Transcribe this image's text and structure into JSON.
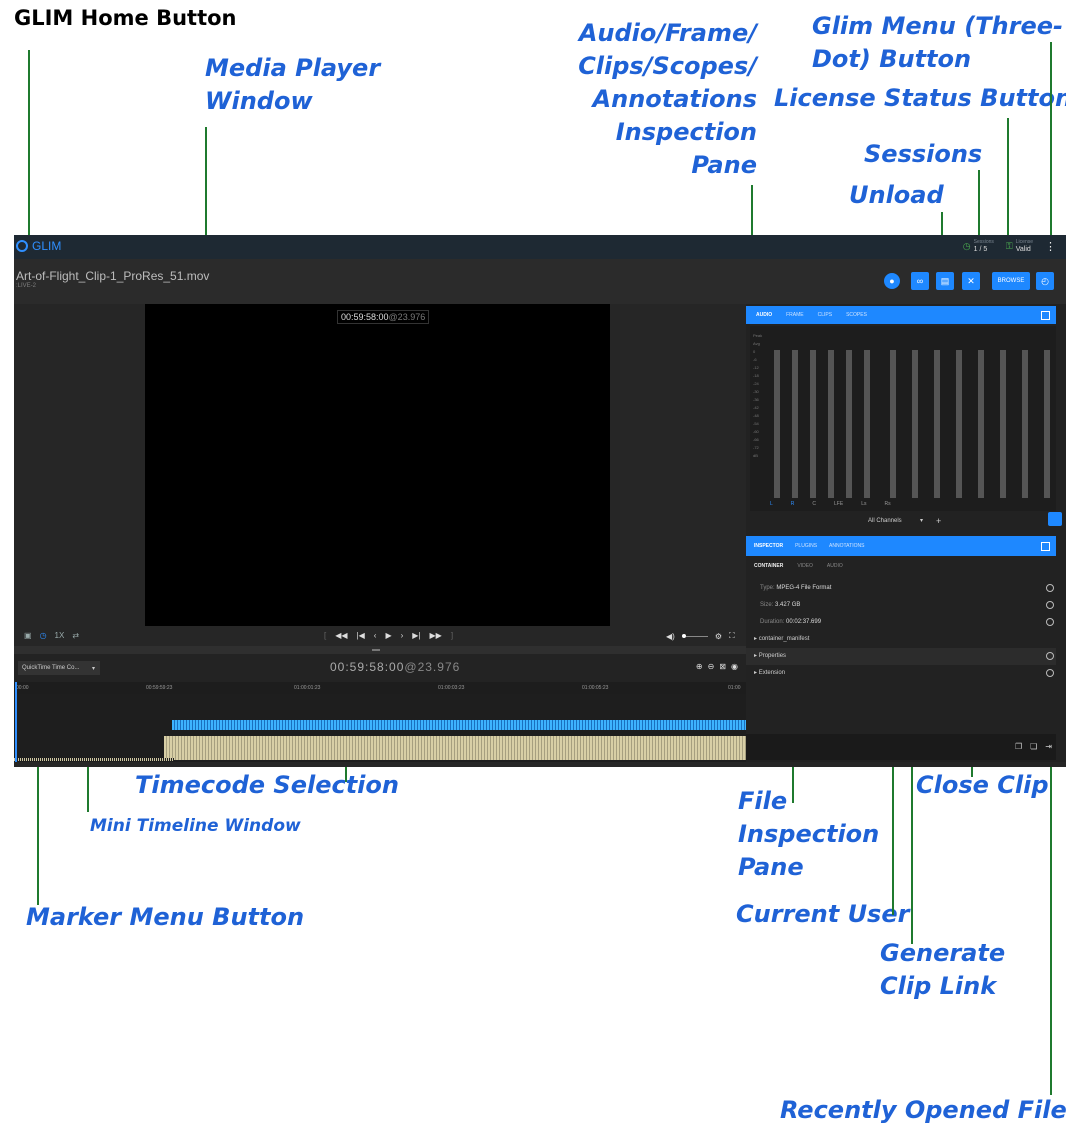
{
  "callouts": {
    "home_button": "GLIM Home Button",
    "media_player": [
      "Media Player",
      "Window"
    ],
    "inspection_pane": [
      "Audio/Frame/",
      "Clips/Scopes/",
      "Annotations",
      "Inspection",
      "Pane"
    ],
    "glim_menu": [
      "Glim Menu (Three-",
      "Dot) Button"
    ],
    "license_status": "License Status Button",
    "sessions": "Sessions",
    "unload": "Unload",
    "timecode_selection": "Timecode Selection",
    "mini_timeline": "Mini Timeline Window",
    "marker_menu": "Marker Menu Button",
    "file_inspection": [
      "File",
      "Inspection",
      "Pane"
    ],
    "close_clip": "Close Clip",
    "current_user": "Current User",
    "generate_clip_link": [
      "Generate",
      "Clip Link"
    ],
    "recently_opened": "Recently Opened Files"
  },
  "app": {
    "logo_text": "GLIM",
    "sessions": {
      "label": "Sessions",
      "value": "1 / 5"
    },
    "license": {
      "label": "License",
      "value": "Valid"
    },
    "menu_glyph": "⋮",
    "file_title": "Art-of-Flight_Clip-1_ProRes_51.mov",
    "file_sub": ":LIVE-2",
    "browse_label": "BROWSE",
    "player": {
      "timecode": "00:59:58:00",
      "rate": "@23.976",
      "speed": "1X"
    },
    "timeline": {
      "select_label": "QuickTime Time Co...",
      "timecode": "00:59:58:00",
      "rate": "@23.976",
      "ruler": [
        "00:00",
        "00:59:59:23",
        "01:00:01:23",
        "01:00:03:23",
        "01:00:05:23",
        "01:00"
      ]
    },
    "audio_tabs": [
      "AUDIO",
      "FRAME",
      "CLIPS",
      "SCOPES"
    ],
    "meter_scale": [
      "Peak",
      "Avg",
      "0",
      "-6",
      "-12",
      "-18",
      "-24",
      "-30",
      "-36",
      "-42",
      "-48",
      "-54",
      "-60",
      "-66",
      "-72",
      "dB"
    ],
    "channels": [
      "L",
      "R",
      "C",
      "LFE",
      "Ls",
      "Rs"
    ],
    "all_channels": "All Channels",
    "inspector_tabs": [
      "INSPECTOR",
      "PLUGINS",
      "ANNOTATIONS"
    ],
    "sub_tabs": [
      "CONTAINER",
      "VIDEO",
      "AUDIO"
    ],
    "inspector": {
      "type_label": "Type:",
      "type_value": "MPEG-4 File Format",
      "size_label": "Size:",
      "size_value": "3.427 GB",
      "duration_label": "Duration:",
      "duration_value": "00:02:37.699",
      "sections": [
        "container_manifest",
        "Properties",
        "Extension"
      ]
    }
  }
}
